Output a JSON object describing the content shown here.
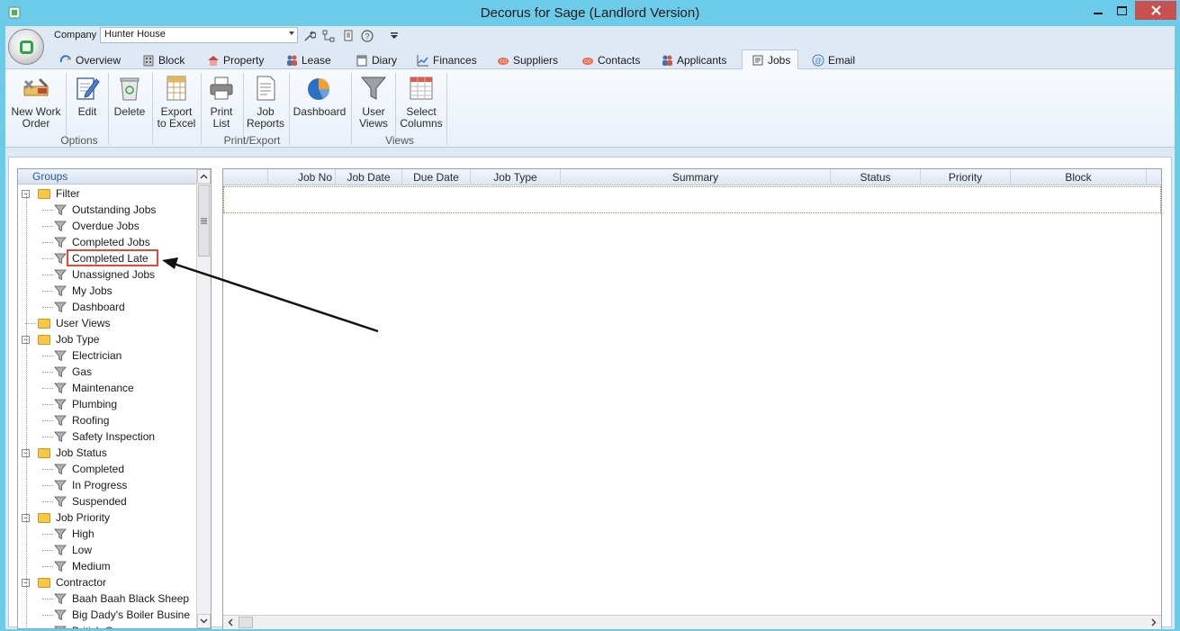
{
  "window": {
    "title": "Decorus for Sage (Landlord Version)"
  },
  "company": {
    "label": "Company",
    "value": "Hunter House"
  },
  "tabs": [
    {
      "label": "Overview",
      "icon": "overview-icon"
    },
    {
      "label": "Block",
      "icon": "block-icon"
    },
    {
      "label": "Property",
      "icon": "property-icon"
    },
    {
      "label": "Lease",
      "icon": "lease-icon"
    },
    {
      "label": "Diary",
      "icon": "diary-icon"
    },
    {
      "label": "Finances",
      "icon": "finances-icon"
    },
    {
      "label": "Suppliers",
      "icon": "suppliers-icon"
    },
    {
      "label": "Contacts",
      "icon": "contacts-icon"
    },
    {
      "label": "Applicants",
      "icon": "applicants-icon"
    },
    {
      "label": "Jobs",
      "icon": "jobs-icon",
      "active": true
    },
    {
      "label": "Email",
      "icon": "email-icon"
    }
  ],
  "ribbon": {
    "new_work_order": "New Work\nOrder",
    "edit": "Edit",
    "delete": "Delete",
    "export_excel": "Export\nto Excel",
    "print_list": "Print\nList",
    "job_reports": "Job\nReports",
    "dashboard": "Dashboard",
    "user_views": "User\nViews",
    "select_columns": "Select\nColumns",
    "group_options": "Options",
    "group_print_export": "Print/Export",
    "group_views": "Views"
  },
  "groups": {
    "header": "Groups",
    "tree": [
      {
        "label": "Filter",
        "type": "folder"
      },
      {
        "label": "Outstanding Jobs",
        "type": "filter"
      },
      {
        "label": "Overdue Jobs",
        "type": "filter"
      },
      {
        "label": "Completed Jobs",
        "type": "filter"
      },
      {
        "label": "Completed Late",
        "type": "filter",
        "highlighted": true
      },
      {
        "label": "Unassigned Jobs",
        "type": "filter"
      },
      {
        "label": "My Jobs",
        "type": "filter"
      },
      {
        "label": "Dashboard",
        "type": "filter"
      },
      {
        "label": "User Views",
        "type": "folder-noexpand"
      },
      {
        "label": "Job Type",
        "type": "folder"
      },
      {
        "label": "Electrician",
        "type": "filter"
      },
      {
        "label": "Gas",
        "type": "filter"
      },
      {
        "label": "Maintenance",
        "type": "filter"
      },
      {
        "label": "Plumbing",
        "type": "filter"
      },
      {
        "label": "Roofing",
        "type": "filter"
      },
      {
        "label": "Safety Inspection",
        "type": "filter"
      },
      {
        "label": "Job Status",
        "type": "folder"
      },
      {
        "label": "Completed",
        "type": "filter"
      },
      {
        "label": "In Progress",
        "type": "filter"
      },
      {
        "label": "Suspended",
        "type": "filter"
      },
      {
        "label": "Job Priority",
        "type": "folder"
      },
      {
        "label": "High",
        "type": "filter"
      },
      {
        "label": "Low",
        "type": "filter"
      },
      {
        "label": "Medium",
        "type": "filter"
      },
      {
        "label": "Contractor",
        "type": "folder"
      },
      {
        "label": "Baah Baah Black Sheep",
        "type": "filter"
      },
      {
        "label": "Big Dady's Boiler Busine",
        "type": "filter"
      },
      {
        "label": "British Gas",
        "type": "filter"
      }
    ]
  },
  "grid": {
    "columns": [
      "",
      "Job No",
      "Job Date",
      "Due Date",
      "Job Type",
      "Summary",
      "Status",
      "Priority",
      "Block"
    ]
  }
}
